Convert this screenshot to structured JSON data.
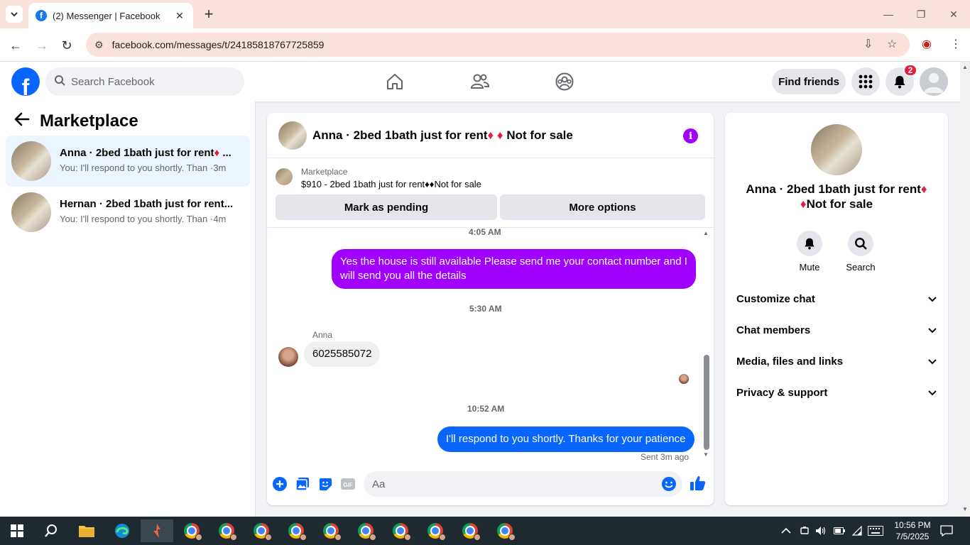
{
  "browser": {
    "tab_title": "(2) Messenger | Facebook",
    "url": "facebook.com/messages/t/24185818767725859"
  },
  "fb": {
    "search_placeholder": "Search Facebook",
    "find_friends": "Find friends",
    "notification_count": "2"
  },
  "sidebar": {
    "title": "Marketplace",
    "conversations": [
      {
        "name": "Anna · 2bed 1bath just for rent",
        "name_suffix": " ...",
        "preview": "You: I'll respond to you shortly. Than...",
        "time": "·3m"
      },
      {
        "name": "Hernan · 2bed 1bath just for rent...",
        "preview": "You: I'll respond to you shortly. Than...",
        "time": "·4m"
      }
    ]
  },
  "chat": {
    "title_part1": "Anna · 2bed 1bath just for rent",
    "title_part2": "Not for sale",
    "marketplace_label": "Marketplace",
    "listing": "$910 - 2bed 1bath just for rent♦♦Not for sale",
    "mark_pending": "Mark as pending",
    "more_options": "More options",
    "messages": [
      {
        "type": "timestamp",
        "text": "4:05 AM"
      },
      {
        "type": "outgoing",
        "text": "Yes the house is still available Please send me your contact number and I will send you all the details"
      },
      {
        "type": "timestamp",
        "text": "5:30 AM"
      },
      {
        "type": "incoming",
        "sender": "Anna",
        "text": "6025585072"
      },
      {
        "type": "timestamp",
        "text": "10:52 AM"
      },
      {
        "type": "outgoing",
        "text": "I'll respond to you shortly. Thanks for your patience"
      }
    ],
    "sent_status": "Sent 3m ago",
    "input_placeholder": "Aa"
  },
  "info": {
    "name_part1": "Anna · 2bed 1bath just for rent",
    "name_part2": "Not for sale",
    "actions": [
      {
        "label": "Mute"
      },
      {
        "label": "Search"
      }
    ],
    "sections": [
      "Customize chat",
      "Chat members",
      "Media, files and links",
      "Privacy & support"
    ]
  },
  "taskbar": {
    "time": "10:56 PM",
    "date": "7/5/2025"
  },
  "colors": {
    "accent_purple": "#a100ff",
    "fb_blue": "#0866ff",
    "diamond_red": "#e41e3f"
  }
}
